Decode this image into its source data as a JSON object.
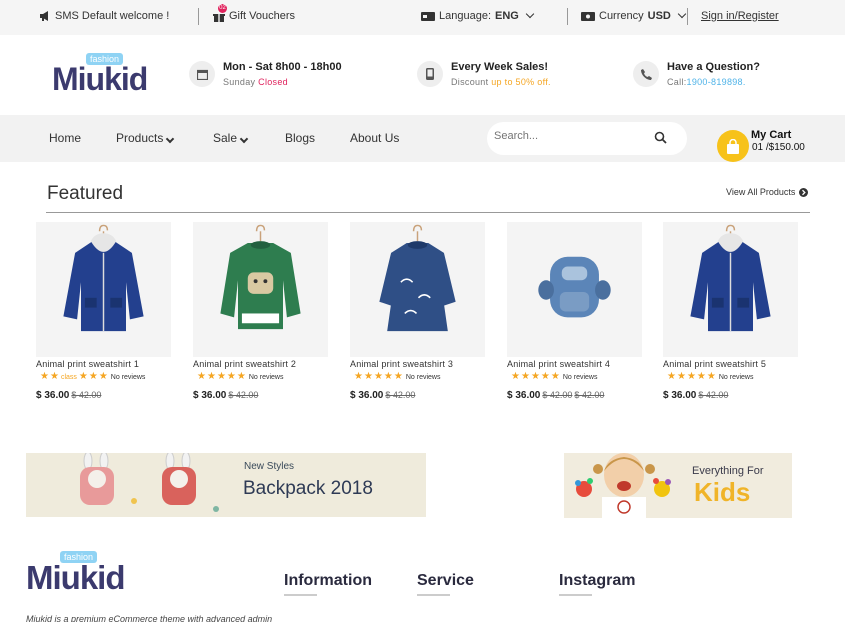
{
  "topbar": {
    "sms": "SMS Default welcome !",
    "gift": "Gift Vouchers",
    "gift_badge": "02",
    "language_label": "Language:",
    "language_value": "ENG",
    "currency_label": "Currency",
    "currency_value": "USD",
    "signin": "Sign in/Register"
  },
  "brand": {
    "tag": "fashion",
    "name": "Miukid"
  },
  "header_info": [
    {
      "title": "Mon - Sat 8h00 - 18h00",
      "sub_a": "Sunday",
      "sub_b": "Closed"
    },
    {
      "title": "Every Week Sales!",
      "sub_a": "Discount",
      "sub_b": "up to 50% off."
    },
    {
      "title": "Have a Question?",
      "sub_a": "Call:",
      "sub_b": "1900-819898."
    }
  ],
  "nav": {
    "items": [
      "Home",
      "Products",
      "Sale",
      "Blogs",
      "About Us"
    ],
    "search_placeholder": "Search...",
    "cart_title": "My Cart",
    "cart_summary": "01 /$150.00"
  },
  "featured": {
    "title": "Featured",
    "view_all": "View All Products",
    "products": [
      {
        "name": "Animal print sweatshirt 1",
        "rating_text": "class",
        "reviews": "No reviews",
        "price": "$ 36.00",
        "old": "$ 42.00",
        "old2": "",
        "stars": 5,
        "color": "#23408e",
        "kind": "jacket"
      },
      {
        "name": "Animal print sweatshirt 2",
        "rating_text": "",
        "reviews": "No reviews",
        "price": "$ 36.00",
        "old": "$ 42.00",
        "old2": "",
        "stars": 5,
        "color": "#2e7d4f",
        "kind": "sweater"
      },
      {
        "name": "Animal print sweatshirt 3",
        "rating_text": "",
        "reviews": "No reviews",
        "price": "$ 36.00",
        "old": "$ 42.00",
        "old2": "",
        "stars": 5,
        "color": "#2f4f86",
        "kind": "dress"
      },
      {
        "name": "Animal print sweatshirt 4",
        "rating_text": "",
        "reviews": "No reviews",
        "price": "$ 36.00",
        "old": "$ 42.00",
        "old2": "$ 42.00",
        "stars": 5,
        "color": "#5b85b8",
        "kind": "backpack"
      },
      {
        "name": "Animal print sweatshirt 5",
        "rating_text": "",
        "reviews": "No reviews",
        "price": "$ 36.00",
        "old": "$ 42.00",
        "old2": "",
        "stars": 5,
        "color": "#23408e",
        "kind": "jacket"
      }
    ]
  },
  "banners": {
    "left_small": "New Styles",
    "left_big": "Backpack 2018",
    "right_small": "Everything For",
    "right_big": "Kids"
  },
  "footer": {
    "headings": [
      "Information",
      "Service",
      "Instagram"
    ],
    "about": "Miukid is a premium eCommerce theme with advanced admin"
  },
  "colors": {
    "accent_red": "#e0245e",
    "accent_yellow": "#f7c21a",
    "brand_dark": "#3b3a6e"
  }
}
